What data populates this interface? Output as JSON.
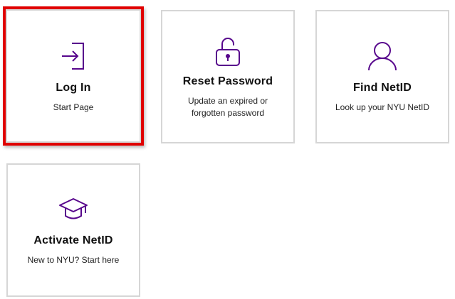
{
  "colors": {
    "accent": "#57068c",
    "highlight_border": "#e00000",
    "card_border": "#d6d6d6"
  },
  "cards": [
    {
      "id": "login",
      "title": "Log In",
      "description": "Start Page",
      "icon": "sign-in-arrow-icon",
      "highlighted": true
    },
    {
      "id": "reset",
      "title": "Reset Password",
      "description": "Update an expired or forgotten password",
      "icon": "unlocked-padlock-icon",
      "highlighted": false
    },
    {
      "id": "find",
      "title": "Find NetID",
      "description": "Look up your NYU NetID",
      "icon": "person-icon",
      "highlighted": false
    },
    {
      "id": "activate",
      "title": "Activate NetID",
      "description": "New to NYU? Start here",
      "icon": "graduation-cap-icon",
      "highlighted": false
    }
  ]
}
